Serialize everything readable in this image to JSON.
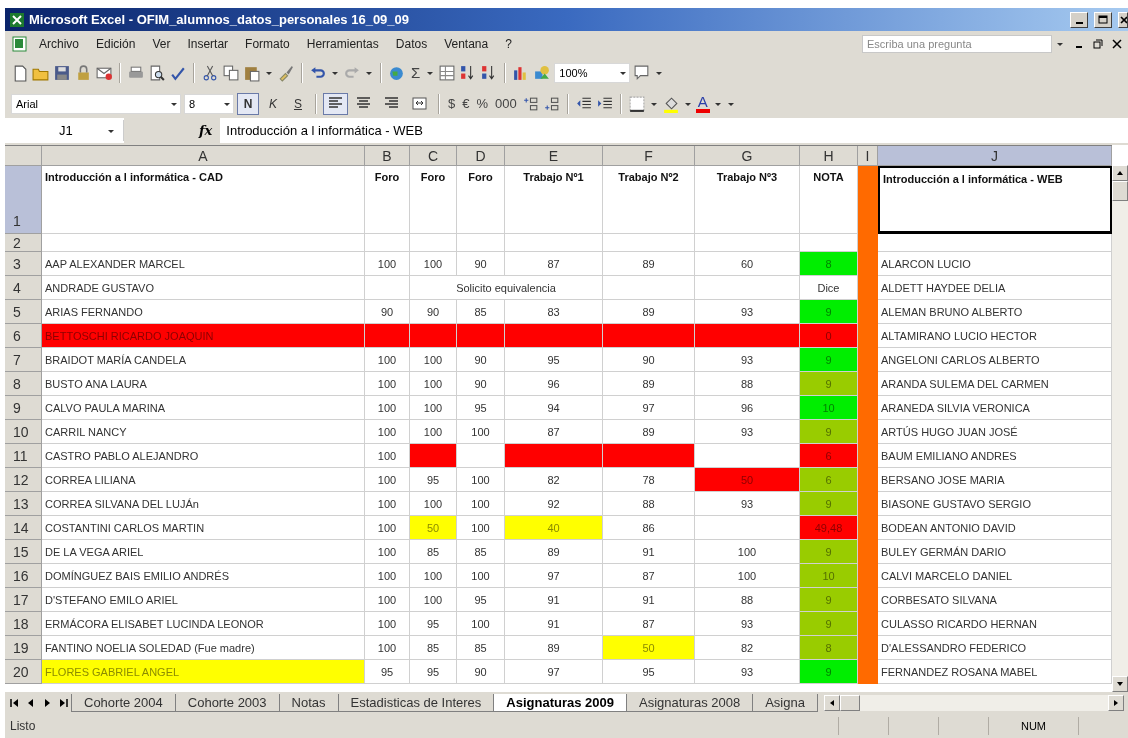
{
  "window": {
    "title": "Microsoft Excel - OFIM_alumnos_datos_personales 16_09_09"
  },
  "menu": [
    "Archivo",
    "Edición",
    "Ver",
    "Insertar",
    "Formato",
    "Herramientas",
    "Datos",
    "Ventana",
    "?"
  ],
  "help_box": {
    "placeholder": "Escriba una pregunta"
  },
  "standard_toolbar": {
    "autosum": "Σ",
    "zoom": "100%"
  },
  "format_toolbar": {
    "font": "Arial",
    "size": "8",
    "style_buttons": [
      {
        "label": "N",
        "on": true
      },
      {
        "label": "K",
        "on": false
      },
      {
        "label": "S",
        "on": false
      }
    ],
    "alignment_buttons": [
      {
        "on": true
      },
      {
        "on": false
      },
      {
        "on": false
      },
      {
        "on": false
      }
    ],
    "number_buttons": [
      "$",
      "€",
      "%",
      "000"
    ],
    "font_color": "A"
  },
  "formula_bar": {
    "cell": "J1",
    "fx": "fx",
    "value": "Introducción a l informática - WEB"
  },
  "columns": [
    {
      "label": "A",
      "selected": false
    },
    {
      "label": "B",
      "selected": false
    },
    {
      "label": "C",
      "selected": false
    },
    {
      "label": "D",
      "selected": false
    },
    {
      "label": "E",
      "selected": false
    },
    {
      "label": "F",
      "selected": false
    },
    {
      "label": "G",
      "selected": false
    },
    {
      "label": "H",
      "selected": false
    },
    {
      "label": "I",
      "selected": false
    },
    {
      "label": "J",
      "selected": true
    }
  ],
  "header_row": {
    "number": "1",
    "selected": true,
    "cells": [
      "Introducción a l informática - CAD",
      "Foro",
      "Foro",
      "Foro",
      "Trabajo Nº1",
      "Trabajo Nº2",
      "Trabajo Nº3",
      "NOTA",
      "Introducción a l informática - WEB"
    ]
  },
  "rows": [
    {
      "number": "2",
      "cells": [
        {},
        {},
        {},
        {},
        {},
        {},
        {},
        {},
        {}
      ]
    },
    {
      "number": "3",
      "cells": [
        {
          "text": "AAP ALEXANDER MARCEL"
        },
        {
          "text": "100"
        },
        {
          "text": "100"
        },
        {
          "text": "90"
        },
        {
          "text": "87"
        },
        {
          "text": "89"
        },
        {
          "text": "60"
        },
        {
          "text": "8",
          "color": "#00ee00"
        },
        {
          "text": "ALARCON LUCIO"
        }
      ]
    },
    {
      "number": "4",
      "cells": [
        {
          "text": "ANDRADE GUSTAVO"
        },
        {},
        {
          "text": "Solicito equivalencia",
          "kind": "merged"
        },
        {},
        {},
        {
          "text": "Dice"
        },
        {
          "text": "ALDETT HAYDEE DELIA"
        }
      ]
    },
    {
      "number": "5",
      "cells": [
        {
          "text": "ARIAS FERNANDO"
        },
        {
          "text": "90"
        },
        {
          "text": "90"
        },
        {
          "text": "85"
        },
        {
          "text": "83"
        },
        {
          "text": "89"
        },
        {
          "text": "93"
        },
        {
          "text": "9",
          "color": "#00ee00"
        },
        {
          "text": "ALEMAN BRUNO ALBERTO"
        }
      ]
    },
    {
      "number": "6",
      "cells": [
        {
          "text": "BETTOSCHI RICARDO JOAQUIN",
          "color": "#ff0000"
        },
        {
          "color": "#ff0000"
        },
        {
          "color": "#ff0000"
        },
        {
          "color": "#ff0000"
        },
        {
          "color": "#ff0000"
        },
        {
          "color": "#ff0000"
        },
        {
          "color": "#ff0000"
        },
        {
          "text": "0",
          "color": "#ff0000"
        },
        {
          "text": "ALTAMIRANO LUCIO HECTOR"
        }
      ]
    },
    {
      "number": "7",
      "cells": [
        {
          "text": "BRAIDOT MARÍA CANDELA"
        },
        {
          "text": "100"
        },
        {
          "text": "100"
        },
        {
          "text": "90"
        },
        {
          "text": "95"
        },
        {
          "text": "90"
        },
        {
          "text": "93"
        },
        {
          "text": "9",
          "color": "#00ee00"
        },
        {
          "text": "ANGELONI CARLOS ALBERTO"
        }
      ]
    },
    {
      "number": "8",
      "cells": [
        {
          "text": "BUSTO ANA LAURA"
        },
        {
          "text": "100"
        },
        {
          "text": "100"
        },
        {
          "text": "90"
        },
        {
          "text": "96"
        },
        {
          "text": "89"
        },
        {
          "text": "88"
        },
        {
          "text": "9",
          "color": "#99cc00"
        },
        {
          "text": "ARANDA SULEMA DEL CARMEN"
        }
      ]
    },
    {
      "number": "9",
      "cells": [
        {
          "text": "CALVO PAULA MARINA"
        },
        {
          "text": "100"
        },
        {
          "text": "100"
        },
        {
          "text": "95"
        },
        {
          "text": "94"
        },
        {
          "text": "97"
        },
        {
          "text": "96"
        },
        {
          "text": "10",
          "color": "#00ee00"
        },
        {
          "text": "ARANEDA SILVIA VERONICA"
        }
      ]
    },
    {
      "number": "10",
      "cells": [
        {
          "text": "CARRIL NANCY"
        },
        {
          "text": "100"
        },
        {
          "text": "100"
        },
        {
          "text": "100"
        },
        {
          "text": "87"
        },
        {
          "text": "89"
        },
        {
          "text": "93"
        },
        {
          "text": "9",
          "color": "#99cc00"
        },
        {
          "text": "ARTÚS HUGO JUAN JOSÉ"
        }
      ]
    },
    {
      "number": "11",
      "cells": [
        {
          "text": "CASTRO PABLO ALEJANDRO"
        },
        {
          "text": "100"
        },
        {
          "color": "#ff0000"
        },
        {},
        {
          "color": "#ff0000"
        },
        {
          "color": "#ff0000"
        },
        {},
        {
          "text": "6",
          "color": "#ff0000"
        },
        {
          "text": "BAUM EMILIANO ANDRES"
        }
      ]
    },
    {
      "number": "12",
      "cells": [
        {
          "text": "CORREA LILIANA"
        },
        {
          "text": "100"
        },
        {
          "text": "95"
        },
        {
          "text": "100"
        },
        {
          "text": "82"
        },
        {
          "text": "78"
        },
        {
          "text": "50",
          "color": "#ff0000"
        },
        {
          "text": "6",
          "color": "#99cc00"
        },
        {
          "text": "BERSANO JOSE MARIA"
        }
      ]
    },
    {
      "number": "13",
      "cells": [
        {
          "text": "CORREA SILVANA DEL LUJÁn"
        },
        {
          "text": "100"
        },
        {
          "text": "100"
        },
        {
          "text": "100"
        },
        {
          "text": "92"
        },
        {
          "text": "88"
        },
        {
          "text": "93"
        },
        {
          "text": "9",
          "color": "#99cc00"
        },
        {
          "text": "BIASONE GUSTAVO SERGIO"
        }
      ]
    },
    {
      "number": "14",
      "cells": [
        {
          "text": "COSTANTINI CARLOS MARTIN"
        },
        {
          "text": "100"
        },
        {
          "text": "50",
          "color": "#ffff00"
        },
        {
          "text": "100"
        },
        {
          "text": "40",
          "color": "#ffff00"
        },
        {
          "text": "86"
        },
        {},
        {
          "text": "49,48",
          "color": "#ff0000"
        },
        {
          "text": "BODEAN ANTONIO DAVID"
        }
      ]
    },
    {
      "number": "15",
      "cells": [
        {
          "text": "DE LA VEGA ARIEL"
        },
        {
          "text": "100"
        },
        {
          "text": "85"
        },
        {
          "text": "85"
        },
        {
          "text": "89"
        },
        {
          "text": "91"
        },
        {
          "text": "100"
        },
        {
          "text": "9",
          "color": "#99cc00"
        },
        {
          "text": "BULEY GERMÁN DARIO"
        }
      ]
    },
    {
      "number": "16",
      "cells": [
        {
          "text": "DOMÍNGUEZ BAIS EMILIO ANDRÉS"
        },
        {
          "text": "100"
        },
        {
          "text": "100"
        },
        {
          "text": "100"
        },
        {
          "text": "97"
        },
        {
          "text": "87"
        },
        {
          "text": "100"
        },
        {
          "text": "10",
          "color": "#99cc00"
        },
        {
          "text": "CALVI MARCELO DANIEL"
        }
      ]
    },
    {
      "number": "17",
      "cells": [
        {
          "text": "D'STEFANO EMILO ARIEL"
        },
        {
          "text": "100"
        },
        {
          "text": "100"
        },
        {
          "text": "95"
        },
        {
          "text": "91"
        },
        {
          "text": "91"
        },
        {
          "text": "88"
        },
        {
          "text": "9",
          "color": "#99cc00"
        },
        {
          "text": "CORBESATO SILVANA"
        }
      ]
    },
    {
      "number": "18",
      "cells": [
        {
          "text": "ERMÁCORA ELISABET LUCINDA LEONOR"
        },
        {
          "text": "100"
        },
        {
          "text": "95"
        },
        {
          "text": "100"
        },
        {
          "text": "91"
        },
        {
          "text": "87"
        },
        {
          "text": "93"
        },
        {
          "text": "9",
          "color": "#99cc00"
        },
        {
          "text": "CULASSO RICARDO HERNAN"
        }
      ]
    },
    {
      "number": "19",
      "cells": [
        {
          "text": "FANTINO NOELIA SOLEDAD (Fue madre)"
        },
        {
          "text": "100"
        },
        {
          "text": "85"
        },
        {
          "text": "85"
        },
        {
          "text": "89"
        },
        {
          "text": "50",
          "color": "#ffff00"
        },
        {
          "text": "82"
        },
        {
          "text": "8",
          "color": "#99cc00"
        },
        {
          "text": "D'ALESSANDRO FEDERICO"
        }
      ]
    },
    {
      "number": "20",
      "cells": [
        {
          "text": "FLORES GABRIEL ANGEL",
          "color": "#ffff00"
        },
        {
          "text": "95"
        },
        {
          "text": "95"
        },
        {
          "text": "90"
        },
        {
          "text": "97"
        },
        {
          "text": "95"
        },
        {
          "text": "93"
        },
        {
          "text": "9",
          "color": "#00ee00"
        },
        {
          "text": "FERNANDEZ ROSANA MABEL"
        }
      ]
    }
  ],
  "sheet_tabs": [
    {
      "label": "Cohorte 2004",
      "selected": false
    },
    {
      "label": "Cohorte 2003",
      "selected": false
    },
    {
      "label": "Notas",
      "selected": false
    },
    {
      "label": "Estadisticas de Interes",
      "selected": false
    },
    {
      "label": "Asignaturas 2009",
      "selected": true
    },
    {
      "label": "Asignaturas 2008",
      "selected": false
    },
    {
      "label": "Asigna",
      "selected": false
    }
  ],
  "status_bar": {
    "message": "Listo",
    "num_lock": "NUM"
  }
}
